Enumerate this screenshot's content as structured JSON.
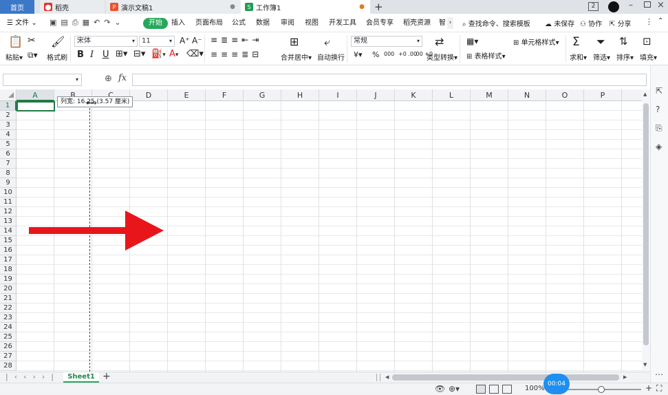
{
  "tabs": {
    "home": "首页",
    "daoke": "稻壳",
    "ppt": "演示文稿1",
    "sheet": "工作簿1",
    "new_tab": "+",
    "badge": "2"
  },
  "menu": {
    "file": "文件",
    "start": "开始",
    "insert": "插入",
    "layout": "页面布局",
    "formula": "公式",
    "data": "数据",
    "review": "审阅",
    "view": "视图",
    "developer": "开发工具",
    "vip": "会员专享",
    "resources": "稻壳资源",
    "smart": "智",
    "search": "查找命令、搜索模板",
    "unsaved": "未保存",
    "collab": "协作",
    "share": "分享"
  },
  "ribbon": {
    "paste": "粘贴",
    "format_painter": "格式刷",
    "font_name": "宋体",
    "font_size": "11",
    "bold": "B",
    "italic": "I",
    "underline": "U",
    "merge_center": "合并居中",
    "wrap_text": "自动换行",
    "number_format": "常规",
    "currency": "¥",
    "percent": "%",
    "thousands": "000",
    "inc_decimal": "+0 .00",
    "dec_decimal": ".00 +0",
    "type_convert": "类型转换",
    "conditional": "条件格式",
    "cell_style": "单元格样式",
    "table_style": "表格样式",
    "sum": "求和",
    "filter": "筛选",
    "sort": "排序",
    "fill": "填充"
  },
  "formula_bar": {
    "name_box": "",
    "fx": "fx",
    "content": ""
  },
  "grid": {
    "columns": [
      "A",
      "B",
      "C",
      "D",
      "E",
      "F",
      "G",
      "H",
      "I",
      "J",
      "K",
      "L",
      "M",
      "N",
      "O",
      "P"
    ],
    "rows": [
      "1",
      "2",
      "3",
      "4",
      "5",
      "6",
      "7",
      "8",
      "9",
      "10",
      "11",
      "12",
      "13",
      "14",
      "15",
      "16",
      "17",
      "18",
      "19",
      "20",
      "21",
      "22",
      "23",
      "24",
      "25",
      "26",
      "27",
      "28"
    ],
    "tooltip": "列宽: 16.25 (3.57 厘米)"
  },
  "sheets": {
    "active": "Sheet1",
    "add": "+"
  },
  "status": {
    "zoom": "100%",
    "timer": "00:04"
  },
  "colors": {
    "accent": "#26a85a",
    "home_tab": "#3b78c8",
    "arrow": "#e8161b"
  }
}
